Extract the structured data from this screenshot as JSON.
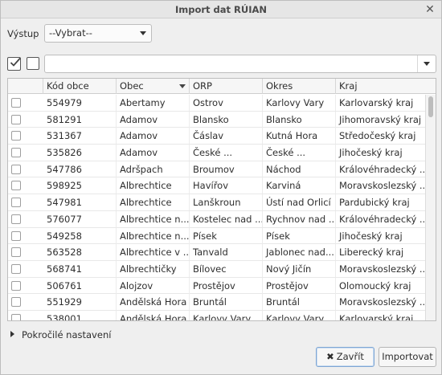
{
  "window": {
    "title": "Import dat RÚIAN",
    "close_icon": "close-icon"
  },
  "output": {
    "label": "Výstup",
    "selected": "--Vybrat--"
  },
  "filter": {
    "value": ""
  },
  "table": {
    "columns": [
      "",
      "Kód obce",
      "Obec",
      "ORP",
      "Okres",
      "Kraj"
    ],
    "sorted_column": "Obec",
    "rows": [
      [
        "554979",
        "Abertamy",
        "Ostrov",
        "Karlovy Vary",
        "Karlovarský kraj"
      ],
      [
        "581291",
        "Adamov",
        "Blansko",
        "Blansko",
        "Jihomoravský kraj"
      ],
      [
        "531367",
        "Adamov",
        "Čáslav",
        "Kutná Hora",
        "Středočeský kraj"
      ],
      [
        "535826",
        "Adamov",
        "České ...",
        "České ...",
        "Jihočeský kraj"
      ],
      [
        "547786",
        "Adršpach",
        "Broumov",
        "Náchod",
        "Královéhradecký ..."
      ],
      [
        "598925",
        "Albrechtice",
        "Havířov",
        "Karviná",
        "Moravskoslezský ..."
      ],
      [
        "547981",
        "Albrechtice",
        "Lanškroun",
        "Ústí nad Orlicí",
        "Pardubický kraj"
      ],
      [
        "576077",
        "Albrechtice n...",
        "Kostelec nad ...",
        "Rychnov nad ...",
        "Královéhradecký ..."
      ],
      [
        "549258",
        "Albrechtice n...",
        "Písek",
        "Písek",
        "Jihočeský kraj"
      ],
      [
        "563528",
        "Albrechtice v ...",
        "Tanvald",
        "Jablonec nad...",
        "Liberecký kraj"
      ],
      [
        "568741",
        "Albrechtičky",
        "Bílovec",
        "Nový Jičín",
        "Moravskoslezský ..."
      ],
      [
        "506761",
        "Alojzov",
        "Prostějov",
        "Prostějov",
        "Olomoucký kraj"
      ],
      [
        "551929",
        "Andělská Hora",
        "Bruntál",
        "Bruntál",
        "Moravskoslezský ..."
      ],
      [
        "538001",
        "Andělská Hora",
        "Karlovy Vary",
        "Karlovy Vary",
        "Karlovarský kraj"
      ]
    ]
  },
  "advanced": {
    "label": "Pokročilé nastavení"
  },
  "buttons": {
    "cancel": "Zavřít",
    "import": "Importovat"
  }
}
